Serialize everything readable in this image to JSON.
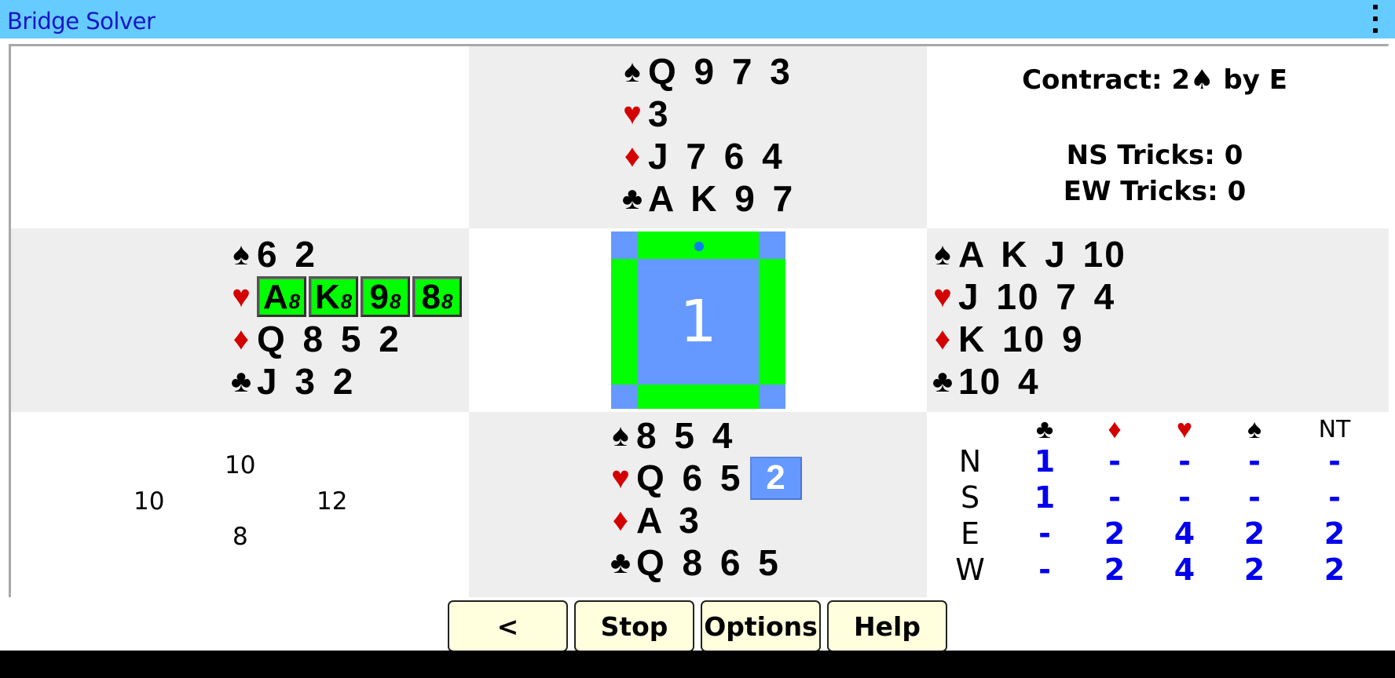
{
  "app": {
    "title": "Bridge Solver",
    "menu_icon": "more-vert-icon"
  },
  "suits": {
    "spade": "♠",
    "heart": "♥",
    "diamond": "♦",
    "club": "♣"
  },
  "hands": {
    "north": {
      "spades": "Q 9 7 3",
      "hearts": "3",
      "diamonds": "J 7 6 4",
      "clubs": "A K 9 7"
    },
    "west": {
      "spades": "6 2",
      "hearts_highlighted": [
        {
          "rank": "A",
          "tricks": "8"
        },
        {
          "rank": "K",
          "tricks": "8"
        },
        {
          "rank": "9",
          "tricks": "8"
        },
        {
          "rank": "8",
          "tricks": "8"
        }
      ],
      "diamonds": "Q 8 5 2",
      "clubs": "J 3 2"
    },
    "east": {
      "spades": "A K J 10",
      "hearts": "J 10 7 4",
      "diamonds": "K 10 9",
      "clubs": "10 4"
    },
    "south": {
      "spades": "8 5 4",
      "hearts": "Q 6 5",
      "hearts_played_badge": "2",
      "diamonds": "A 3",
      "clubs": "Q 8 6 5"
    }
  },
  "trick": {
    "number": "1",
    "leader_indicator": "north"
  },
  "status": {
    "contract_label": "Contract: 2",
    "contract_suit": "♠",
    "contract_by": " by E",
    "ns_tricks": "NS Tricks: 0",
    "ew_tricks": "EW Tricks: 0"
  },
  "hcp": {
    "north": "10",
    "west": "10",
    "east": "12",
    "south": "8"
  },
  "double_dummy_table": {
    "columns": [
      "♣",
      "♦",
      "♥",
      "♠",
      "NT"
    ],
    "rows": [
      {
        "seat": "N",
        "values": [
          "1",
          "-",
          "-",
          "-",
          "-"
        ]
      },
      {
        "seat": "S",
        "values": [
          "1",
          "-",
          "-",
          "-",
          "-"
        ]
      },
      {
        "seat": "E",
        "values": [
          "-",
          "2",
          "4",
          "2",
          "2"
        ]
      },
      {
        "seat": "W",
        "values": [
          "-",
          "2",
          "4",
          "2",
          "2"
        ]
      }
    ]
  },
  "buttons": {
    "back": "<",
    "stop": "Stop",
    "options": "Options",
    "help": "Help"
  },
  "colors": {
    "titlebar": "#66ccff",
    "highlight_card": "#00ff00",
    "trick_blue": "#6699ff",
    "table_value": "#0000ee",
    "red_suit": "#d40000",
    "button_bg": "#ffffdd"
  }
}
